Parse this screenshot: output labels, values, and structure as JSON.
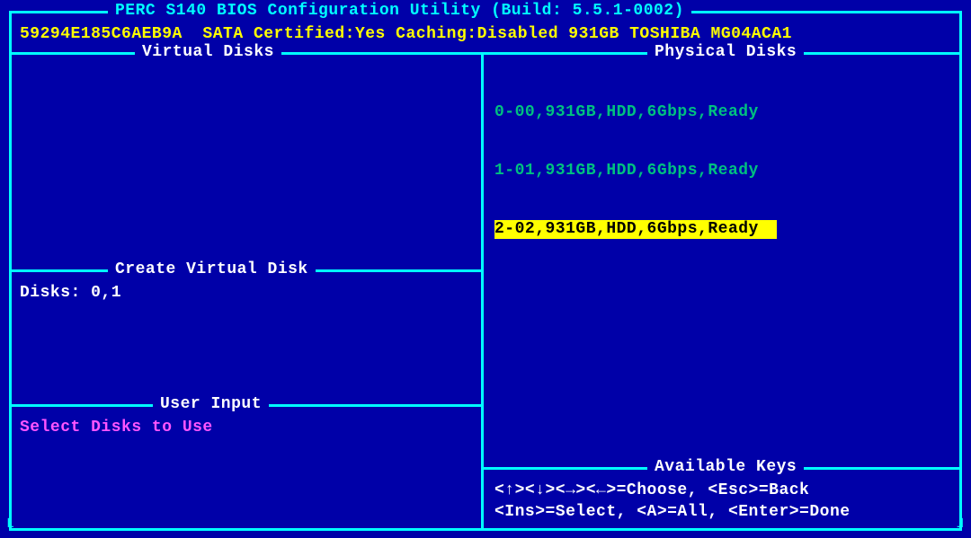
{
  "header": {
    "title": "PERC S140 BIOS Configuration Utility (Build: 5.5.1-0002)",
    "subtitle": "59294E185C6AEB9A  SATA Certified:Yes Caching:Disabled 931GB TOSHIBA MG04ACA1"
  },
  "panels": {
    "virtual_disks": {
      "title": "Virtual Disks"
    },
    "physical_disks": {
      "title": "Physical Disks"
    },
    "create_vd": {
      "title": "Create Virtual Disk",
      "disks_line": "Disks: 0,1"
    },
    "user_input": {
      "title": "User Input",
      "prompt": "Select Disks to Use"
    },
    "available_keys": {
      "title": "Available Keys",
      "line1": "<↑><↓><→><←>=Choose, <Esc>=Back",
      "line2": "<Ins>=Select, <A>=All, <Enter>=Done"
    }
  },
  "physical_disks": [
    {
      "text": "0-00,931GB,HDD,6Gbps,Ready",
      "selected": false
    },
    {
      "text": "1-01,931GB,HDD,6Gbps,Ready",
      "selected": false
    },
    {
      "text": "2-02,931GB,HDD,6Gbps,Ready",
      "selected": true
    }
  ]
}
